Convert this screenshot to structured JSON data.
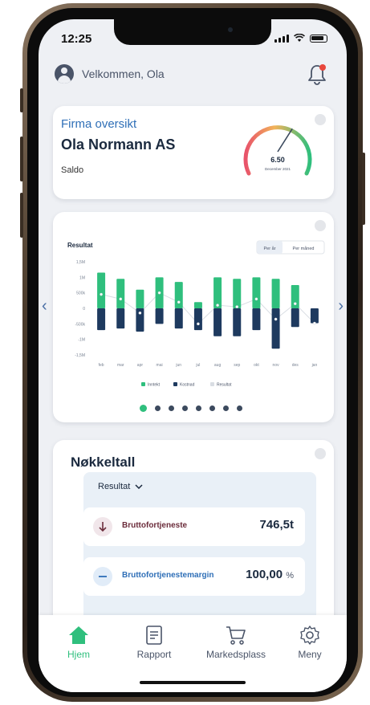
{
  "status": {
    "time": "12:25"
  },
  "header": {
    "greeting": "Velkommen, Ola"
  },
  "firma": {
    "title": "Firma oversikt",
    "company": "Ola Normann AS",
    "saldo_label": "Saldo",
    "gauge_value": "6.50",
    "gauge_date": "December 2021",
    "gauge_fraction": 0.62
  },
  "chart_data": {
    "type": "bar",
    "title": "Resultat",
    "toggle_options": [
      "Per år",
      "Per måned"
    ],
    "categories": [
      "feb",
      "mar",
      "apr",
      "mai",
      "jun",
      "jul",
      "aug",
      "sep",
      "okt",
      "nov",
      "des",
      "jan"
    ],
    "yticks": [
      "1,5M",
      "1M",
      "500k",
      "0",
      "-500k",
      "-1M",
      "-1,5M"
    ],
    "ylim": [
      -1500,
      1500
    ],
    "y_unit": "k",
    "series": [
      {
        "name": "Inntekt",
        "color": "#2fbf7d",
        "values": [
          1150,
          950,
          600,
          1000,
          850,
          200,
          1000,
          950,
          1000,
          950,
          750,
          0
        ]
      },
      {
        "name": "Kostnad",
        "color": "#1e3a5f",
        "values": [
          -700,
          -650,
          -750,
          -500,
          -650,
          -700,
          -900,
          -900,
          -700,
          -1300,
          -600,
          -480
        ]
      },
      {
        "name": "Resultat",
        "color": "#d9dde3",
        "values": [
          450,
          300,
          -150,
          500,
          200,
          -500,
          100,
          50,
          300,
          -350,
          150,
          -480
        ]
      }
    ]
  },
  "pager": {
    "count": 8,
    "active": 0
  },
  "nokkel": {
    "title": "Nøkkeltall",
    "selector": "Resultat",
    "rows": [
      {
        "label": "Bruttofortjeneste",
        "value": "746,5t",
        "suffix": ""
      },
      {
        "label": "Bruttofortjenestemargin",
        "value": "100,00",
        "suffix": "%"
      }
    ]
  },
  "tabs": [
    {
      "label": "Hjem",
      "icon": "home-icon"
    },
    {
      "label": "Rapport",
      "icon": "report-icon"
    },
    {
      "label": "Markedsplass",
      "icon": "cart-icon"
    },
    {
      "label": "Meny",
      "icon": "gear-icon"
    }
  ],
  "colors": {
    "accent": "#2fbf7d",
    "navy": "#1e3a5f",
    "link": "#2f6fb7"
  }
}
